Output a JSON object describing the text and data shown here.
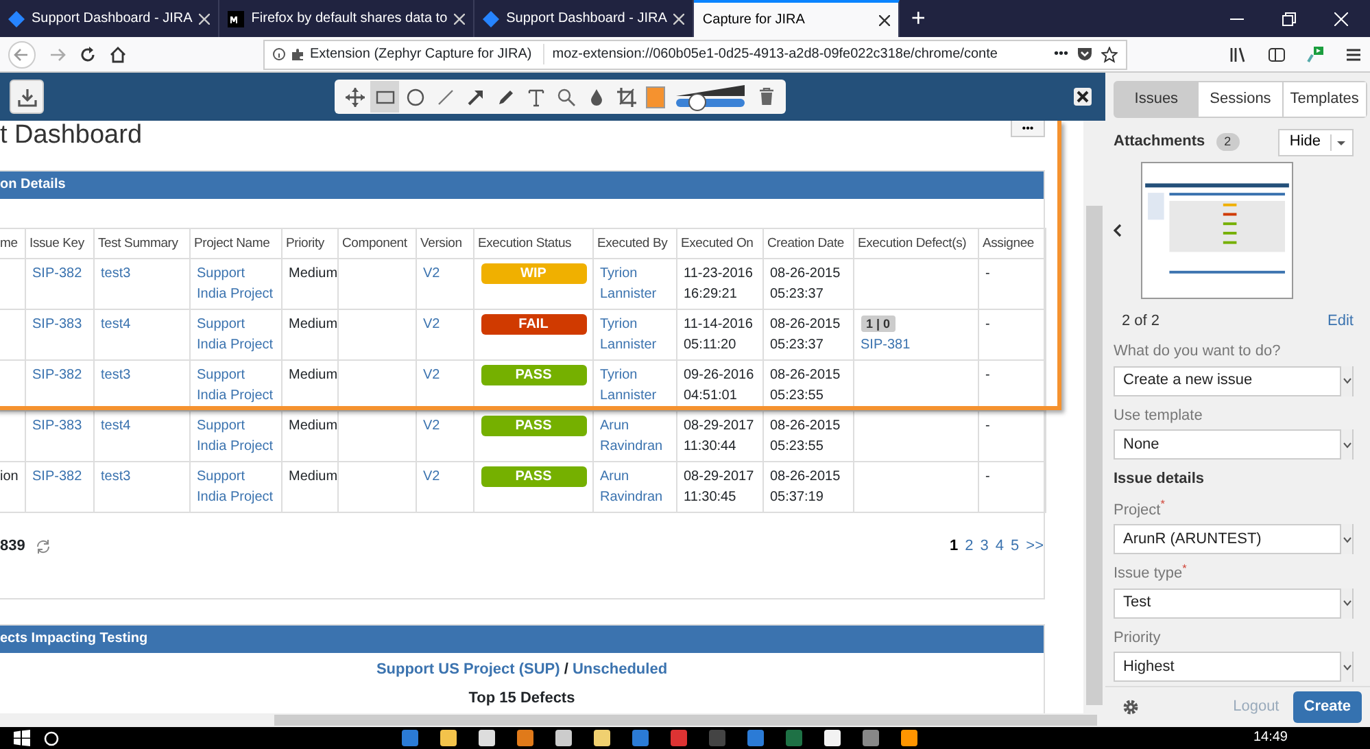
{
  "browser": {
    "tabs": [
      {
        "title": "Support Dashboard - JIRA",
        "kind": "jira",
        "selected": false
      },
      {
        "title": "Firefox by default shares data to",
        "kind": "medium",
        "selected": false
      },
      {
        "title": "Support Dashboard - JIRA",
        "kind": "jira",
        "selected": false
      },
      {
        "title": "Capture for JIRA",
        "kind": "plain",
        "selected": true
      }
    ],
    "new_tab": "+",
    "url_bar": {
      "identity": "Extension (Zephyr Capture for JIRA)",
      "url": "moz-extension://060b05e1-0d25-4913-a2d8-09fe022c318e/chrome/conte",
      "more": "•••"
    }
  },
  "capture_toolbar": {
    "tools": [
      {
        "kind": "move",
        "selected": false
      },
      {
        "kind": "rectangle",
        "selected": true
      },
      {
        "kind": "ellipse",
        "selected": false
      },
      {
        "kind": "line",
        "selected": false
      },
      {
        "kind": "arrow",
        "selected": false
      },
      {
        "kind": "pencil",
        "selected": false
      },
      {
        "kind": "text",
        "selected": false
      },
      {
        "kind": "zoom",
        "selected": false
      },
      {
        "kind": "blur",
        "selected": false
      },
      {
        "kind": "crop",
        "selected": false
      }
    ],
    "color": "#f5922f",
    "stroke_size": {
      "level": 0.3
    }
  },
  "page": {
    "title": "t Dashboard",
    "more": "•••",
    "executions": {
      "title": "on Details",
      "columns": [
        "me",
        "Issue Key",
        "Test Summary",
        "Project Name",
        "Priority",
        "Component",
        "Version",
        "Execution Status",
        "Executed By",
        "Executed On",
        "Creation Date",
        "Execution Defect(s)",
        "Assignee"
      ],
      "rows": [
        {
          "issue_key": "SIP-382",
          "test_summary": "test3",
          "project": "Support India Project",
          "priority": "Medium",
          "version": "V2",
          "status": {
            "label": "WIP",
            "color": "#f0b000"
          },
          "executed_by": "Tyrion Lannister",
          "executed_on": "11-23-2016 16:29:21",
          "created": "08-26-2015 05:23:37",
          "assignee": "-"
        },
        {
          "issue_key": "SIP-383",
          "test_summary": "test4",
          "project": "Support India Project",
          "priority": "Medium",
          "version": "V2",
          "status": {
            "label": "FAIL",
            "color": "#d03a00"
          },
          "executed_by": "Tyrion Lannister",
          "executed_on": "11-14-2016 05:11:20",
          "created": "08-26-2015 05:23:37",
          "defects": {
            "count": "1 | 0",
            "key": "SIP-381"
          },
          "assignee": "-"
        },
        {
          "issue_key": "SIP-382",
          "test_summary": "test3",
          "project": "Support India Project",
          "priority": "Medium",
          "version": "V2",
          "status": {
            "label": "PASS",
            "color": "#75b000"
          },
          "executed_by": "Tyrion Lannister",
          "executed_on": "09-26-2016 04:51:01",
          "created": "08-26-2015 05:23:55",
          "assignee": "-"
        },
        {
          "issue_key": "SIP-383",
          "test_summary": "test4",
          "project": "Support India Project",
          "priority": "Medium",
          "version": "V2",
          "status": {
            "label": "PASS",
            "color": "#75b000"
          },
          "executed_by": "Arun Ravindran",
          "executed_on": "08-29-2017 11:30:44",
          "created": "08-26-2015 05:23:55",
          "assignee": "-"
        },
        {
          "name": "ion",
          "issue_key": "SIP-382",
          "test_summary": "test3",
          "project": "Support India Project",
          "priority": "Medium",
          "version": "V2",
          "status": {
            "label": "PASS",
            "color": "#75b000"
          },
          "executed_by": "Arun Ravindran",
          "executed_on": "08-29-2017 11:30:45",
          "created": "08-26-2015 05:37:19",
          "assignee": "-"
        }
      ],
      "total": "839",
      "pages": [
        {
          "label": "1",
          "selected": true
        },
        {
          "label": "2",
          "selected": false
        },
        {
          "label": "3",
          "selected": false
        },
        {
          "label": "4",
          "selected": false
        },
        {
          "label": "5",
          "selected": false
        },
        {
          "label": ">>",
          "selected": false
        }
      ]
    },
    "defects": {
      "title": "ects Impacting Testing",
      "project_link": "Support US Project (SUP)",
      "separator": "/",
      "version_link": "Unscheduled",
      "subtitle": "Top 15 Defects"
    }
  },
  "sidebar": {
    "tabs": [
      {
        "label": "Issues",
        "selected": true
      },
      {
        "label": "Sessions",
        "selected": false
      },
      {
        "label": "Templates",
        "selected": false
      }
    ],
    "attachments": {
      "title": "Attachments",
      "count": "2",
      "hide": "Hide",
      "position": "2 of 2",
      "edit": "Edit"
    },
    "fields": [
      {
        "label": "What do you want to do?",
        "value": "Create a new issue"
      },
      {
        "label": "Use template",
        "value": "None"
      },
      {
        "kind": "heading",
        "label": "Issue details"
      },
      {
        "label": "Project$^{*}$",
        "value": "ArunR (ARUNTEST)"
      },
      {
        "label": "Issue type$^{*}$",
        "value": "Test"
      },
      {
        "label": "Priority",
        "value": "Highest"
      }
    ],
    "logout": "Logout",
    "create": "Create"
  },
  "taskbar": {
    "time": "14:49"
  }
}
